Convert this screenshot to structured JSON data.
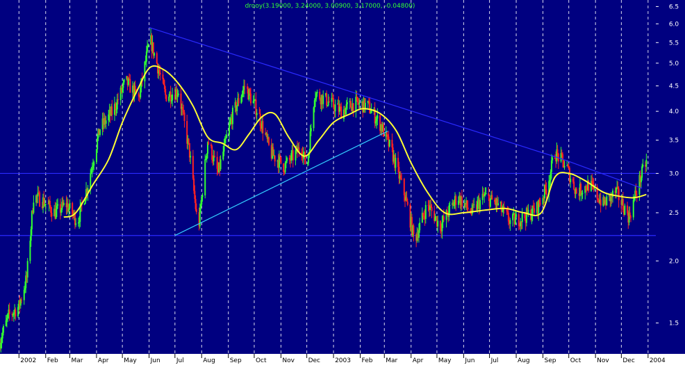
{
  "colors": {
    "background": "#000080",
    "grid": "#ffffff",
    "up_candle": "#33ff33",
    "down_candle": "#ff2222",
    "moving_average": "#ffff33",
    "trendline_blue": "#2a2aff",
    "trendline_cyan": "#33ccff",
    "axis_panel": "#ffffff",
    "ticker_text": "#33ff33"
  },
  "chart_data": {
    "type": "line",
    "title": "drooy(3.19000, 3.24000, 3.00900, 3.17000, -0.04800)",
    "y_scale": "log",
    "ylim": [
      1.3,
      6.7
    ],
    "yticks": [
      "6.5",
      "6.0",
      "5.5",
      "5.0",
      "4.5",
      "4.0",
      "3.5",
      "3.0",
      "2.5",
      "2.0",
      "1.5"
    ],
    "ytick_values": [
      6.5,
      6.0,
      5.5,
      5.0,
      4.5,
      4.0,
      3.5,
      3.0,
      2.5,
      2.0,
      1.5
    ],
    "xticks": [
      "2002",
      "Feb",
      "Mar",
      "Apr",
      "May",
      "Jun",
      "Jul",
      "Aug",
      "Sep",
      "Oct",
      "Nov",
      "Dec",
      "2003",
      "Feb",
      "Mar",
      "Apr",
      "May",
      "Jun",
      "Jul",
      "Aug",
      "Sep",
      "Oct",
      "Nov",
      "Dec",
      "2004"
    ],
    "xtick_dates": [
      "2002-01-01",
      "2002-02-01",
      "2002-03-01",
      "2002-04-01",
      "2002-05-01",
      "2002-06-01",
      "2002-07-01",
      "2002-08-01",
      "2002-09-01",
      "2002-10-01",
      "2002-11-01",
      "2002-12-01",
      "2003-01-01",
      "2003-02-01",
      "2003-03-01",
      "2003-04-01",
      "2003-05-01",
      "2003-06-01",
      "2003-07-01",
      "2003-08-01",
      "2003-09-01",
      "2003-10-01",
      "2003-11-01",
      "2003-12-01",
      "2004-01-01"
    ],
    "x_range": [
      "2001-12-10",
      "2004-01-10"
    ],
    "grid": true,
    "legend": "none",
    "price_path": [
      [
        "2001-12-08",
        1.35
      ],
      [
        "2001-12-20",
        1.55
      ],
      [
        "2002-01-01",
        1.62
      ],
      [
        "2002-01-10",
        1.85
      ],
      [
        "2002-01-18",
        2.7
      ],
      [
        "2002-01-28",
        2.65
      ],
      [
        "2002-02-12",
        2.5
      ],
      [
        "2002-02-25",
        2.6
      ],
      [
        "2002-03-10",
        2.4
      ],
      [
        "2002-03-22",
        2.85
      ],
      [
        "2002-04-05",
        3.7
      ],
      [
        "2002-04-20",
        4.0
      ],
      [
        "2002-05-05",
        4.6
      ],
      [
        "2002-05-20",
        4.25
      ],
      [
        "2002-06-02",
        5.6
      ],
      [
        "2002-06-10",
        5.0
      ],
      [
        "2002-06-20",
        4.3
      ],
      [
        "2002-07-05",
        4.4
      ],
      [
        "2002-07-18",
        3.3
      ],
      [
        "2002-07-28",
        2.3
      ],
      [
        "2002-08-08",
        3.5
      ],
      [
        "2002-08-20",
        3.0
      ],
      [
        "2002-09-05",
        3.9
      ],
      [
        "2002-09-20",
        4.5
      ],
      [
        "2002-10-05",
        4.0
      ],
      [
        "2002-10-20",
        3.3
      ],
      [
        "2002-11-05",
        3.1
      ],
      [
        "2002-11-25",
        3.4
      ],
      [
        "2002-12-01",
        3.05
      ],
      [
        "2002-12-10",
        4.35
      ],
      [
        "2002-12-25",
        4.2
      ],
      [
        "2003-01-10",
        4.0
      ],
      [
        "2003-01-25",
        4.15
      ],
      [
        "2003-02-10",
        4.1
      ],
      [
        "2003-02-25",
        3.75
      ],
      [
        "2003-03-10",
        3.3
      ],
      [
        "2003-03-25",
        2.7
      ],
      [
        "2003-04-05",
        2.2
      ],
      [
        "2003-04-20",
        2.6
      ],
      [
        "2003-05-05",
        2.35
      ],
      [
        "2003-05-25",
        2.7
      ],
      [
        "2003-06-10",
        2.5
      ],
      [
        "2003-06-25",
        2.7
      ],
      [
        "2003-07-10",
        2.6
      ],
      [
        "2003-07-25",
        2.4
      ],
      [
        "2003-08-10",
        2.45
      ],
      [
        "2003-08-25",
        2.55
      ],
      [
        "2003-09-05",
        2.8
      ],
      [
        "2003-09-15",
        3.3
      ],
      [
        "2003-09-28",
        3.1
      ],
      [
        "2003-10-10",
        2.75
      ],
      [
        "2003-10-25",
        2.85
      ],
      [
        "2003-11-10",
        2.6
      ],
      [
        "2003-11-25",
        2.75
      ],
      [
        "2003-12-10",
        2.45
      ],
      [
        "2003-12-22",
        2.9
      ],
      [
        "2003-12-30",
        3.17
      ]
    ],
    "moving_average": [
      [
        "2002-02-22",
        2.45
      ],
      [
        "2002-03-08",
        2.5
      ],
      [
        "2002-03-28",
        2.85
      ],
      [
        "2002-04-15",
        3.2
      ],
      [
        "2002-05-01",
        3.8
      ],
      [
        "2002-05-18",
        4.4
      ],
      [
        "2002-06-02",
        4.9
      ],
      [
        "2002-06-18",
        4.85
      ],
      [
        "2002-07-05",
        4.55
      ],
      [
        "2002-07-22",
        4.1
      ],
      [
        "2002-08-08",
        3.55
      ],
      [
        "2002-08-25",
        3.45
      ],
      [
        "2002-09-10",
        3.35
      ],
      [
        "2002-09-25",
        3.6
      ],
      [
        "2002-10-10",
        3.9
      ],
      [
        "2002-10-25",
        3.95
      ],
      [
        "2002-11-10",
        3.55
      ],
      [
        "2002-11-28",
        3.25
      ],
      [
        "2002-12-15",
        3.5
      ],
      [
        "2003-01-01",
        3.8
      ],
      [
        "2003-01-20",
        3.95
      ],
      [
        "2003-02-05",
        4.05
      ],
      [
        "2003-02-25",
        3.95
      ],
      [
        "2003-03-15",
        3.65
      ],
      [
        "2003-04-01",
        3.15
      ],
      [
        "2003-04-20",
        2.75
      ],
      [
        "2003-05-10",
        2.5
      ],
      [
        "2003-06-01",
        2.5
      ],
      [
        "2003-06-25",
        2.53
      ],
      [
        "2003-07-20",
        2.55
      ],
      [
        "2003-08-10",
        2.5
      ],
      [
        "2003-08-30",
        2.5
      ],
      [
        "2003-09-15",
        2.95
      ],
      [
        "2003-10-01",
        3.0
      ],
      [
        "2003-10-20",
        2.9
      ],
      [
        "2003-11-10",
        2.75
      ],
      [
        "2003-11-28",
        2.7
      ],
      [
        "2003-12-15",
        2.68
      ],
      [
        "2003-12-30",
        2.72
      ]
    ],
    "trendlines": [
      {
        "kind": "blue",
        "from": [
          "2002-06-01",
          5.9
        ],
        "to": [
          "2003-09-25",
          3.2
        ]
      },
      {
        "kind": "blue",
        "from": [
          "2003-09-25",
          3.2
        ],
        "to": [
          "2003-12-25",
          2.8
        ]
      },
      {
        "kind": "cyan",
        "from": [
          "2002-07-01",
          2.25
        ],
        "to": [
          "2003-03-05",
          3.65
        ]
      }
    ],
    "horizontal_lines": [
      3.0,
      2.25
    ]
  }
}
